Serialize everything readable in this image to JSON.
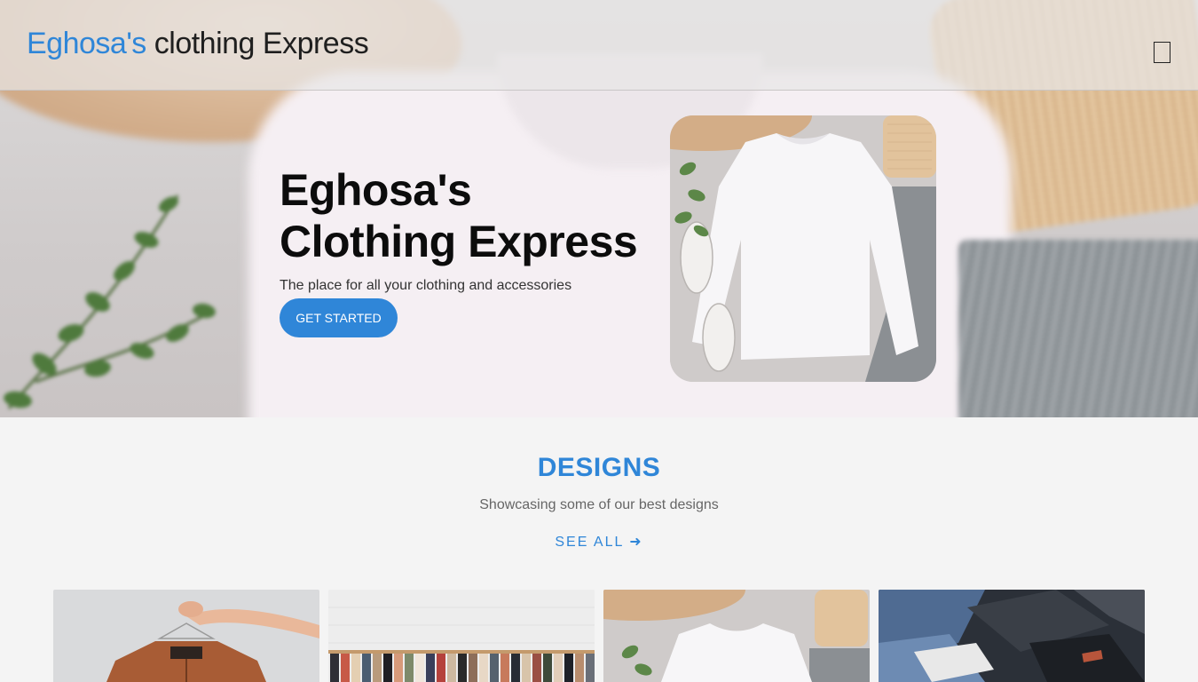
{
  "header": {
    "logo_brand": "Eghosa's",
    "logo_rest": " clothing Express",
    "menu_icon": "menu-icon"
  },
  "hero": {
    "title_line1": "Eghosa's",
    "title_line2": "Clothing Express",
    "subtitle": "The place for all your clothing and accessories",
    "cta_label": "GET STARTED"
  },
  "designs": {
    "title": "DESIGNS",
    "subtitle": "Showcasing some of our best designs",
    "see_all_label": "SEE ALL ➜",
    "tiles": [
      {
        "name": "brown-jacket-on-hanger"
      },
      {
        "name": "clothing-rack"
      },
      {
        "name": "white-sweater-flatlay"
      },
      {
        "name": "denim-pile"
      }
    ]
  },
  "colors": {
    "accent": "#2f86d8",
    "background": "#f4f4f4",
    "text_dark": "#0c0c0c"
  }
}
